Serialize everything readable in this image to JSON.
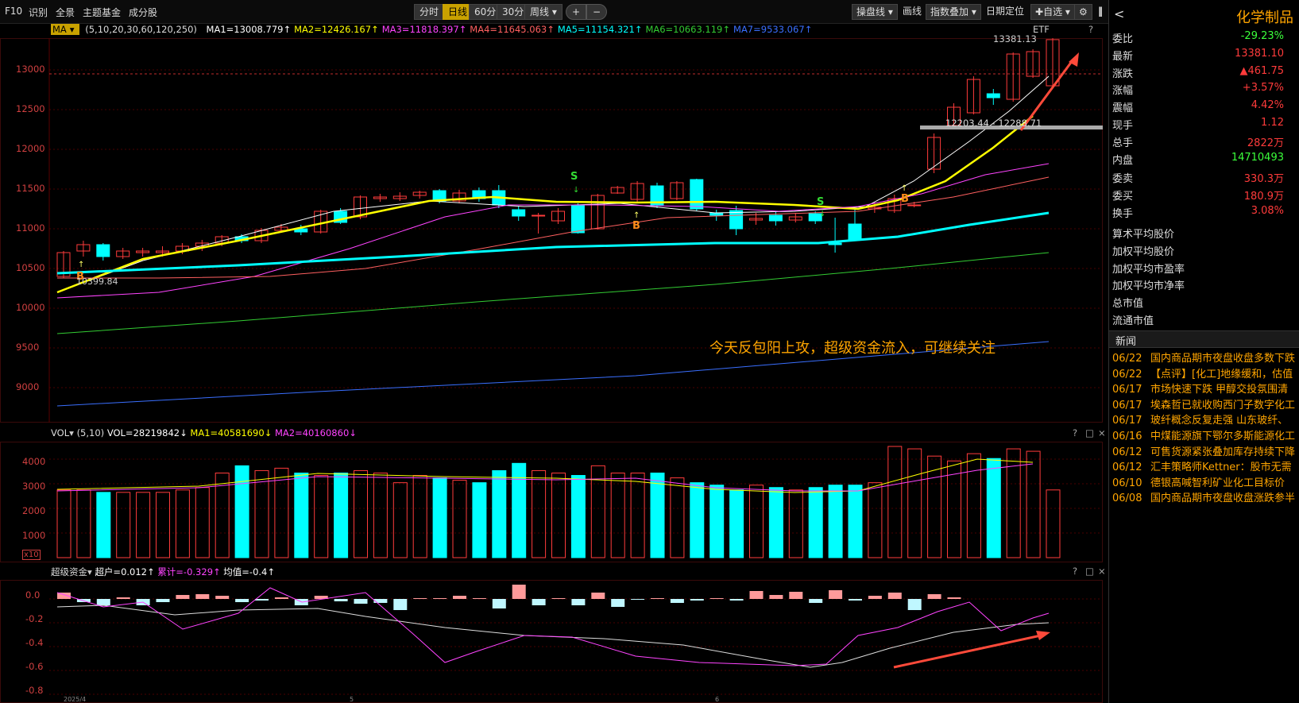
{
  "toolbar": {
    "left_items": [
      "F10",
      "识别",
      "全景",
      "主题基金",
      "成分股"
    ],
    "periods": [
      "分时",
      "日线",
      "60分",
      "30分"
    ],
    "period_active": "日线",
    "period_dropdown": "周线",
    "zoom_in": "+",
    "zoom_out": "−",
    "tools": [
      "操盘线",
      "画线",
      "指数叠加",
      "日期定位",
      "自选"
    ]
  },
  "ma_bar": {
    "selector": "MA",
    "params": "(5,10,20,30,60,120,250)",
    "items": [
      {
        "text": "MA1=13008.779↑",
        "color": "#ffffff"
      },
      {
        "text": "MA2=12426.167↑",
        "color": "#ffff00"
      },
      {
        "text": "MA3=11818.397↑",
        "color": "#ff44ff"
      },
      {
        "text": "MA4=11645.063↑",
        "color": "#ff6060"
      },
      {
        "text": "MA5=11154.321↑",
        "color": "#00ffff"
      },
      {
        "text": "MA6=10663.119↑",
        "color": "#33cc33"
      },
      {
        "text": "MA7=9533.067↑",
        "color": "#3a6fff"
      }
    ],
    "etf": "ETF",
    "help": "?"
  },
  "main_chart": {
    "y_ticks": [
      "13000",
      "12500",
      "12000",
      "11500",
      "11000",
      "10500",
      "10000",
      "9500",
      "9000"
    ],
    "high_label": "13381.13",
    "low_label": "10399.84",
    "range_label": "12203.44 - 12288.71",
    "annotation": "今天反包阳上攻，超级资金流入，可继续关注",
    "signals": [
      "S",
      "B",
      "S",
      "B"
    ]
  },
  "vol_chart": {
    "selector": "VOL",
    "params": "(5,10)",
    "vol_text": "VOL=28219842↓",
    "ma1_text": "MA1=40581690↓",
    "ma2_text": "MA2=40160860↓",
    "y_ticks": [
      "4000",
      "3000",
      "2000",
      "1000"
    ],
    "unit": "x10",
    "panel_btns": [
      "?",
      "□",
      "×"
    ]
  },
  "fund_chart": {
    "selector": "超级资金",
    "hu_text": "超户=0.012↑",
    "lei_text": "累计=-0.329↑",
    "jun_text": "均值=-0.4↑",
    "y_ticks": [
      "0.0",
      "-0.2",
      "-0.4",
      "-0.6",
      "-0.8"
    ],
    "panel_btns": [
      "?",
      "□",
      "×"
    ]
  },
  "right_panel": {
    "title": "化学制品",
    "back": "<",
    "quote": [
      {
        "k": "委比",
        "v": "-29.23%",
        "c": "green"
      },
      {
        "k": "最新",
        "v": "13381.10",
        "c": "red"
      },
      {
        "k": "涨跌",
        "v": "▲461.75",
        "c": "red"
      },
      {
        "k": "涨幅",
        "v": "+3.57%",
        "c": "red"
      },
      {
        "k": "震幅",
        "v": "4.42%",
        "c": "red"
      },
      {
        "k": "现手",
        "v": "1.12",
        "c": "red"
      },
      {
        "k": "总手",
        "v": "2822万",
        "c": "red"
      },
      {
        "k": "内盘",
        "v": "14710493",
        "c": "green"
      }
    ],
    "quote2": [
      {
        "k": "委卖",
        "v": "330.3万",
        "c": "red"
      },
      {
        "k": "委买",
        "v": "180.9万",
        "c": "red"
      },
      {
        "k": "换手",
        "v": "3.08%",
        "c": "red"
      }
    ],
    "metrics": [
      "算术平均股价",
      "加权平均股价",
      "加权平均市盈率",
      "加权平均市净率",
      "总市值",
      "流通市值"
    ],
    "news_title": "新闻",
    "news": [
      {
        "d": "06/22",
        "t": "国内商品期市夜盘收盘多数下跌"
      },
      {
        "d": "06/22",
        "t": "【点评】[化工]地缘缓和，估值"
      },
      {
        "d": "06/17",
        "t": "市场快速下跌 甲醇交投氛围清"
      },
      {
        "d": "06/17",
        "t": "埃森哲已就收购西门子数字化工"
      },
      {
        "d": "06/17",
        "t": "玻纤概念反复走强 山东玻纤、"
      },
      {
        "d": "06/16",
        "t": "中煤能源旗下鄂尔多斯能源化工"
      },
      {
        "d": "06/12",
        "t": "可售货源紧张叠加库存持续下降"
      },
      {
        "d": "06/12",
        "t": "汇丰策略师Kettner：股市无需"
      },
      {
        "d": "06/10",
        "t": "德银高喊智利矿业化工目标价"
      },
      {
        "d": "06/08",
        "t": "国内商品期市夜盘收盘涨跌参半"
      }
    ]
  },
  "x_labels": [
    "2025/4",
    "5",
    "6"
  ],
  "colors": {
    "up": "#ff3b3b",
    "down": "#00ffff",
    "grid": "#5a0000",
    "accent": "#c9a200"
  }
}
